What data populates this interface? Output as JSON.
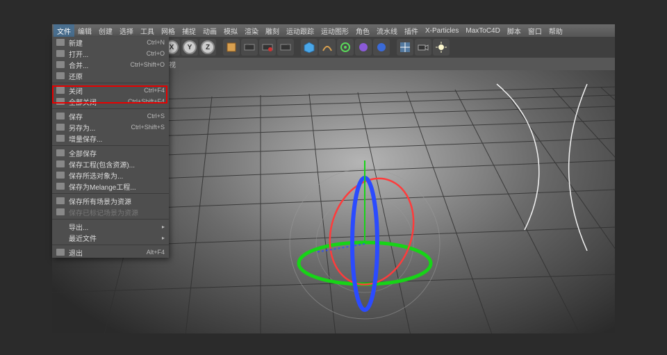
{
  "menu": {
    "items": [
      "文件",
      "编辑",
      "创建",
      "选择",
      "工具",
      "网格",
      "捕捉",
      "动画",
      "模拟",
      "渲染",
      "雕刻",
      "运动跟踪",
      "运动图形",
      "角色",
      "流水线",
      "插件",
      "X-Particles",
      "MaxToC4D",
      "脚本",
      "窗口",
      "帮助"
    ],
    "active_index": 0
  },
  "toolbar": {
    "xyz": [
      "X",
      "Y",
      "Z"
    ]
  },
  "tabbar": {
    "tab0": "透视"
  },
  "file_menu": {
    "items": [
      {
        "label": "新建",
        "shortcut": "Ctrl+N",
        "icon": "ic-blue"
      },
      {
        "label": "打开...",
        "shortcut": "Ctrl+O",
        "icon": "ic-orange"
      },
      {
        "label": "合并...",
        "shortcut": "Ctrl+Shift+O",
        "icon": "ic-orange"
      },
      {
        "label": "还原",
        "shortcut": "",
        "icon": "ic-gray"
      },
      {
        "sep": true
      },
      {
        "label": "关闭",
        "shortcut": "Ctrl+F4",
        "icon": "ic-dark"
      },
      {
        "label": "全部关闭",
        "shortcut": "Ctrl+Shift+F4",
        "icon": "ic-dark"
      },
      {
        "sep": true
      },
      {
        "label": "保存",
        "shortcut": "Ctrl+S",
        "icon": "ic-orange"
      },
      {
        "label": "另存为...",
        "shortcut": "Ctrl+Shift+S",
        "icon": "ic-orange"
      },
      {
        "label": "增量保存...",
        "shortcut": "",
        "icon": "ic-orange"
      },
      {
        "sep": true
      },
      {
        "label": "全部保存",
        "shortcut": "",
        "icon": "ic-orange"
      },
      {
        "label": "保存工程(包含资源)...",
        "shortcut": "",
        "icon": "ic-orange"
      },
      {
        "label": "保存所选对象为...",
        "shortcut": "",
        "icon": "ic-gray"
      },
      {
        "label": "保存为Melange工程...",
        "shortcut": "",
        "icon": "ic-gray"
      },
      {
        "sep": true
      },
      {
        "label": "保存所有场景为资源",
        "shortcut": "",
        "icon": "ic-green"
      },
      {
        "label": "保存已标记场景为资源",
        "shortcut": "",
        "icon": "ic-gray",
        "disabled": true
      },
      {
        "sep": true
      },
      {
        "label": "导出...",
        "shortcut": "",
        "submenu": true,
        "icon": ""
      },
      {
        "label": "最近文件",
        "shortcut": "",
        "submenu": true,
        "icon": ""
      },
      {
        "sep": true
      },
      {
        "label": "退出",
        "shortcut": "Alt+F4",
        "icon": "ic-gray"
      }
    ]
  }
}
